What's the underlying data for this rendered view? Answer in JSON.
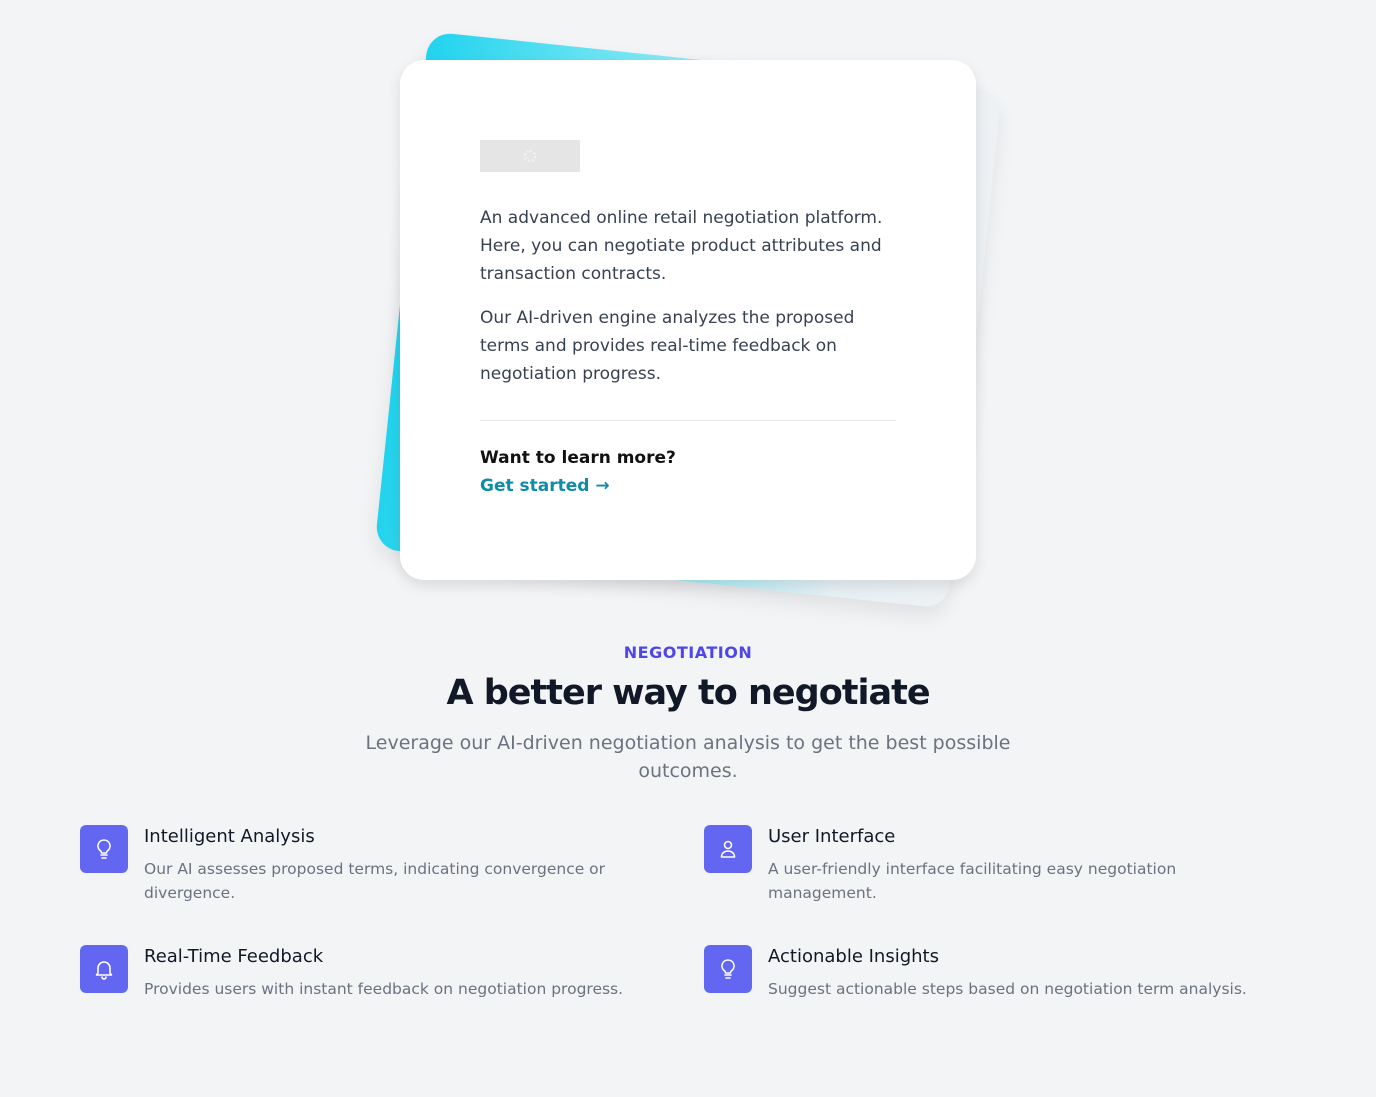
{
  "card": {
    "logo_icon": "image-placeholder-icon",
    "paragraph_1": "An advanced online retail negotiation platform. Here, you can negotiate product attributes and transaction contracts.",
    "paragraph_2": "Our AI-driven engine analyzes the proposed terms and provides real-time feedback on negotiation progress.",
    "learn_more": "Want to learn more?",
    "get_started": "Get started →"
  },
  "section": {
    "eyebrow": "NEGOTIATION",
    "title": "A better way to negotiate",
    "subtitle": "Leverage our AI-driven negotiation analysis to get the best possible outcomes."
  },
  "features": [
    {
      "icon": "lightbulb-icon",
      "title": "Intelligent Analysis",
      "description": "Our AI assesses proposed terms, indicating convergence or divergence."
    },
    {
      "icon": "user-icon",
      "title": "User Interface",
      "description": "A user-friendly interface facilitating easy negotiation management."
    },
    {
      "icon": "bell-icon",
      "title": "Real-Time Feedback",
      "description": "Provides users with instant feedback on negotiation progress."
    },
    {
      "icon": "lightbulb-icon",
      "title": "Actionable Insights",
      "description": "Suggest actionable steps based on negotiation term analysis."
    }
  ],
  "colors": {
    "accent": "#6366f1",
    "eyebrow": "#4f46e5",
    "link": "#0e8ca8",
    "gradient_start": "#22d3ee"
  }
}
